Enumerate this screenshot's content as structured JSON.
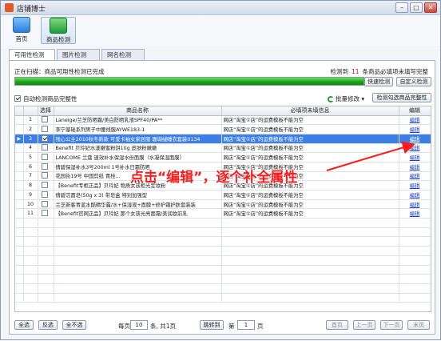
{
  "window": {
    "title": "店铺博士",
    "min": "–",
    "max": "□",
    "close": "✕"
  },
  "toolbar": {
    "home_label": "首页",
    "check_label": "商品检测"
  },
  "tabs": [
    "可用性检测",
    "图片检测",
    "网名检测"
  ],
  "scan": {
    "status": "正在扫描：商品可用性检测已完成",
    "detect_label": "检测到",
    "count": "11",
    "count_suffix": "条商品必填项未填写完整"
  },
  "progress": {
    "percent": 100
  },
  "buttons": {
    "quick": "快速检测",
    "custom": "自定义检测",
    "batch": "批量修改",
    "detect_checked": "检测勾选商品完整性"
  },
  "auto_check": {
    "label": "自动检测商品完整性",
    "checked": true
  },
  "table": {
    "headers": [
      "选择",
      "商品名称",
      "必填项未填信息",
      "编辑"
    ],
    "rows": [
      {
        "no": "1",
        "name": "Laneige/兰芝防晒霜/美白防晒乳液SPF40/PA**",
        "info": "网店“淘宝①店”的运费模板不能为空",
        "edit": "编辑",
        "checked": false,
        "selected": false
      },
      {
        "no": "2",
        "name": "李宁基础系列男子中腰线服AYWE183-1",
        "info": "网店“淘宝①店”的运费模板不能为空",
        "edit": "编辑",
        "checked": false,
        "selected": false
      },
      {
        "no": "3",
        "name": "残心公主2010秋冬新款 可爱卡袖女家居服 珊瑚绒睡衣套装0134",
        "info": "网店“淘宝①店”的运费模板不能为空",
        "edit": "编辑",
        "checked": true,
        "selected": true
      },
      {
        "no": "4",
        "name": "Benefit 贝玲妃水漾嫩蜜粉饼10g 皮肤粉嫩嫩",
        "info": "网店“淘宝①店”的运费模板不能为空",
        "edit": "编辑",
        "checked": false,
        "selected": false
      },
      {
        "no": "5",
        "name": "LANCOME 兰蔻 速效补水保湿水份面膜（水凝保湿面膜）",
        "info": "网店“淘宝①店”的运费模板不能为空",
        "edit": "编辑",
        "checked": false,
        "selected": false
      },
      {
        "no": "6",
        "name": "倩碧保湿补水3号200ml 1号补水日霜防晒",
        "info": "网店“淘宝①店”的运费模板不能为空",
        "edit": "编辑",
        "checked": false,
        "selected": false
      },
      {
        "no": "7",
        "name": "花园街19号 中国剪纸 青桂…",
        "info": "网店“淘宝①店”的运费模板不能为空",
        "edit": "编辑",
        "checked": false,
        "selected": false
      },
      {
        "no": "8",
        "name": "【Benefit专柜正品】贝玲妃 物质女孩柜光定妆粉",
        "info": "网店“淘宝①店”的运费模板不能为空",
        "edit": "编辑",
        "checked": false,
        "selected": false
      },
      {
        "no": "9",
        "name": "倩碧洁面皂(50g x 3) 带皂盒 特别加强型",
        "info": "网店“淘宝①店”的运费模板不能为空",
        "edit": "编辑",
        "checked": false,
        "selected": false
      },
      {
        "no": "10",
        "name": "兰芝新客青蓝水酷精华露/水+保湿液+面膜+修护霜护肤套装装",
        "info": "网店“淘宝①店”的运费模板不能为空",
        "edit": "编辑",
        "checked": false,
        "selected": false
      },
      {
        "no": "11",
        "name": "【Benefit官网正品】贝玲妃 那个女孩光亮面霜/美润妆前乳",
        "info": "网店“淘宝①店”的运费模板不能为空",
        "edit": "编辑",
        "checked": false,
        "selected": false
      }
    ]
  },
  "annotation": {
    "text": "点击“编辑”，逐个补全属性"
  },
  "pager": {
    "select_all": "全选",
    "invert": "反选",
    "none": "全不选",
    "per_page_label": "每页",
    "per_page": "10",
    "total_label": "条, 共1页",
    "jump": "跳转到",
    "page_prefix": "第",
    "page": "1",
    "page_suffix": "页",
    "first": "首页",
    "prev": "上一页",
    "next": "下一页",
    "last": "末页"
  },
  "colors": {
    "accent": "#3d7fe6",
    "progress": "#1aa41a",
    "annotation": "#ff1a1a",
    "count": "#d01010"
  }
}
